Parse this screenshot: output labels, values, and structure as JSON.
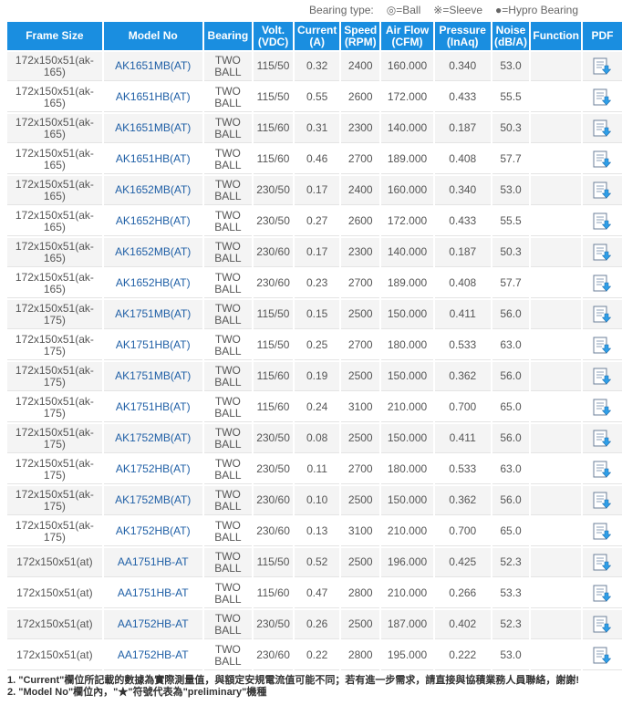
{
  "legend": {
    "label": "Bearing type:",
    "ball": "◎=Ball",
    "sleeve": "※=Sleeve",
    "hypro": "●=Hypro Bearing"
  },
  "headers": {
    "frame_size": "Frame Size",
    "model_no": "Model No",
    "bearing": "Bearing",
    "volt": "Volt. (VDC)",
    "current": "Current (A)",
    "speed": "Speed (RPM)",
    "airflow": "Air Flow (CFM)",
    "pressure": "Pressure (InAq)",
    "noise": "Noise (dB/A)",
    "function": "Function",
    "pdf": "PDF"
  },
  "rows": [
    {
      "frame": "172x150x51(ak-165)",
      "model": "AK1651MB(AT)",
      "bearing": "TWO BALL",
      "volt": "115/50",
      "current": "0.32",
      "speed": "2400",
      "airflow": "160.000",
      "pressure": "0.340",
      "noise": "53.0",
      "function": ""
    },
    {
      "frame": "172x150x51(ak-165)",
      "model": "AK1651HB(AT)",
      "bearing": "TWO BALL",
      "volt": "115/50",
      "current": "0.55",
      "speed": "2600",
      "airflow": "172.000",
      "pressure": "0.433",
      "noise": "55.5",
      "function": ""
    },
    {
      "frame": "172x150x51(ak-165)",
      "model": "AK1651MB(AT)",
      "bearing": "TWO BALL",
      "volt": "115/60",
      "current": "0.31",
      "speed": "2300",
      "airflow": "140.000",
      "pressure": "0.187",
      "noise": "50.3",
      "function": ""
    },
    {
      "frame": "172x150x51(ak-165)",
      "model": "AK1651HB(AT)",
      "bearing": "TWO BALL",
      "volt": "115/60",
      "current": "0.46",
      "speed": "2700",
      "airflow": "189.000",
      "pressure": "0.408",
      "noise": "57.7",
      "function": ""
    },
    {
      "frame": "172x150x51(ak-165)",
      "model": "AK1652MB(AT)",
      "bearing": "TWO BALL",
      "volt": "230/50",
      "current": "0.17",
      "speed": "2400",
      "airflow": "160.000",
      "pressure": "0.340",
      "noise": "53.0",
      "function": ""
    },
    {
      "frame": "172x150x51(ak-165)",
      "model": "AK1652HB(AT)",
      "bearing": "TWO BALL",
      "volt": "230/50",
      "current": "0.27",
      "speed": "2600",
      "airflow": "172.000",
      "pressure": "0.433",
      "noise": "55.5",
      "function": ""
    },
    {
      "frame": "172x150x51(ak-165)",
      "model": "AK1652MB(AT)",
      "bearing": "TWO BALL",
      "volt": "230/60",
      "current": "0.17",
      "speed": "2300",
      "airflow": "140.000",
      "pressure": "0.187",
      "noise": "50.3",
      "function": ""
    },
    {
      "frame": "172x150x51(ak-165)",
      "model": "AK1652HB(AT)",
      "bearing": "TWO BALL",
      "volt": "230/60",
      "current": "0.23",
      "speed": "2700",
      "airflow": "189.000",
      "pressure": "0.408",
      "noise": "57.7",
      "function": ""
    },
    {
      "frame": "172x150x51(ak-175)",
      "model": "AK1751MB(AT)",
      "bearing": "TWO BALL",
      "volt": "115/50",
      "current": "0.15",
      "speed": "2500",
      "airflow": "150.000",
      "pressure": "0.411",
      "noise": "56.0",
      "function": ""
    },
    {
      "frame": "172x150x51(ak-175)",
      "model": "AK1751HB(AT)",
      "bearing": "TWO BALL",
      "volt": "115/50",
      "current": "0.25",
      "speed": "2700",
      "airflow": "180.000",
      "pressure": "0.533",
      "noise": "63.0",
      "function": ""
    },
    {
      "frame": "172x150x51(ak-175)",
      "model": "AK1751MB(AT)",
      "bearing": "TWO BALL",
      "volt": "115/60",
      "current": "0.19",
      "speed": "2500",
      "airflow": "150.000",
      "pressure": "0.362",
      "noise": "56.0",
      "function": ""
    },
    {
      "frame": "172x150x51(ak-175)",
      "model": "AK1751HB(AT)",
      "bearing": "TWO BALL",
      "volt": "115/60",
      "current": "0.24",
      "speed": "3100",
      "airflow": "210.000",
      "pressure": "0.700",
      "noise": "65.0",
      "function": ""
    },
    {
      "frame": "172x150x51(ak-175)",
      "model": "AK1752MB(AT)",
      "bearing": "TWO BALL",
      "volt": "230/50",
      "current": "0.08",
      "speed": "2500",
      "airflow": "150.000",
      "pressure": "0.411",
      "noise": "56.0",
      "function": ""
    },
    {
      "frame": "172x150x51(ak-175)",
      "model": "AK1752HB(AT)",
      "bearing": "TWO BALL",
      "volt": "230/50",
      "current": "0.11",
      "speed": "2700",
      "airflow": "180.000",
      "pressure": "0.533",
      "noise": "63.0",
      "function": ""
    },
    {
      "frame": "172x150x51(ak-175)",
      "model": "AK1752MB(AT)",
      "bearing": "TWO BALL",
      "volt": "230/60",
      "current": "0.10",
      "speed": "2500",
      "airflow": "150.000",
      "pressure": "0.362",
      "noise": "56.0",
      "function": ""
    },
    {
      "frame": "172x150x51(ak-175)",
      "model": "AK1752HB(AT)",
      "bearing": "TWO BALL",
      "volt": "230/60",
      "current": "0.13",
      "speed": "3100",
      "airflow": "210.000",
      "pressure": "0.700",
      "noise": "65.0",
      "function": ""
    },
    {
      "frame": "172x150x51(at)",
      "model": "AA1751HB-AT",
      "bearing": "TWO BALL",
      "volt": "115/50",
      "current": "0.52",
      "speed": "2500",
      "airflow": "196.000",
      "pressure": "0.425",
      "noise": "52.3",
      "function": ""
    },
    {
      "frame": "172x150x51(at)",
      "model": "AA1751HB-AT",
      "bearing": "TWO BALL",
      "volt": "115/60",
      "current": "0.47",
      "speed": "2800",
      "airflow": "210.000",
      "pressure": "0.266",
      "noise": "53.3",
      "function": ""
    },
    {
      "frame": "172x150x51(at)",
      "model": "AA1752HB-AT",
      "bearing": "TWO BALL",
      "volt": "230/50",
      "current": "0.26",
      "speed": "2500",
      "airflow": "187.000",
      "pressure": "0.402",
      "noise": "52.3",
      "function": ""
    },
    {
      "frame": "172x150x51(at)",
      "model": "AA1752HB-AT",
      "bearing": "TWO BALL",
      "volt": "230/60",
      "current": "0.22",
      "speed": "2800",
      "airflow": "195.000",
      "pressure": "0.222",
      "noise": "53.0",
      "function": ""
    }
  ],
  "notes": {
    "note1": "1. \"Current\"欄位所記載的數據為實際測量值，與額定安規電流值可能不同；若有進一步需求，請直接與協積業務人員聯絡，謝謝!",
    "note2": "2. \"Model No\"欄位內，\"★\"符號代表為\"preliminary\"機種"
  },
  "icons": {
    "pdf": "pdf-document-icon"
  },
  "colors": {
    "header_bg": "#1a8ee0",
    "model_link": "#1f5fa6",
    "row_alt": "#f4f4f4"
  }
}
